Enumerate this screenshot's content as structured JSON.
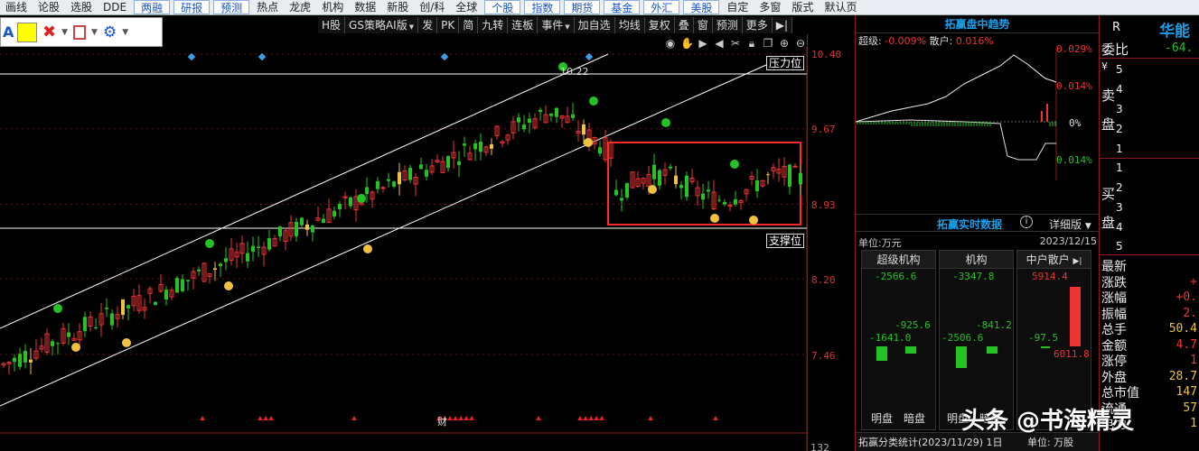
{
  "menu": [
    "画线",
    "论股",
    "选股",
    "DDE",
    "两融",
    "研报",
    "预测",
    "热点",
    "龙虎",
    "机构",
    "数据",
    "新股",
    "创/科",
    "全球",
    "个股",
    "指数",
    "期货",
    "基金",
    "外汇",
    "美股",
    "自定",
    "多窗",
    "版式",
    "默认页"
  ],
  "menu_highlight": [
    "两融",
    "研报",
    "预测",
    "个股",
    "指数",
    "期货",
    "基金",
    "外汇",
    "美股"
  ],
  "toolbox": {
    "a_label": "A",
    "yellow_color": "#ffff00"
  },
  "chart_toolbar": [
    "H股",
    "GS策略AI版",
    "发",
    "PK",
    "简",
    "九转",
    "连板",
    "事件",
    "加自选",
    "均线",
    "复权",
    "叠",
    "窗",
    "预测",
    "更多",
    "▶|"
  ],
  "chart_toolbar_dropdowns": [
    "GS策略AI版",
    "事件"
  ],
  "chart_icons": [
    "eye-icon",
    "hand-icon",
    "play-circle-icon",
    "left-circle-icon",
    "cut-icon",
    "lock-icon",
    "copy-icon",
    "zoom-in-icon",
    "zoom-out-icon"
  ],
  "price_axis": {
    "ticks": [
      "10.40",
      "9.67",
      "8.93",
      "8.20",
      "7.46"
    ],
    "bottom_label": "132"
  },
  "chart_annotations": {
    "resistance": "压力位",
    "support": "支撑位",
    "high_label": "10.22",
    "finance_marker": "财"
  },
  "colors": {
    "up": "#ee3333",
    "down": "#22c322",
    "signal_yellow": "#f0c040",
    "diamond": "#3aa0e8",
    "box": "#ff2a2a"
  },
  "right_panel": {
    "title": "拓赢盘中趋势",
    "super_label": "超级:",
    "super_value": "-0.009%",
    "retail_label": "散户:",
    "retail_value": "0.016%",
    "pct_top": "0.029%",
    "pct_mid_up": "0.014%",
    "pct_zero": "0%",
    "pct_mid_down": "0.014%",
    "realtime_title": "拓赢实时数据",
    "help": "i",
    "mode": "详细版",
    "unit": "单位:万元",
    "date": "2023/12/15",
    "columns": [
      {
        "name": "超级机构",
        "top": "-2566.6",
        "v1": "-925.6",
        "v2": "-1641.0",
        "foot1": "明盘",
        "foot2": "暗盘"
      },
      {
        "name": "机构",
        "top": "-3347.8",
        "v1": "-841.2",
        "v2": "-2506.6",
        "foot1": "明盘",
        "foot2": "暗盘"
      },
      {
        "name": "中户散户",
        "top": "5914.4",
        "v1": "-97.5",
        "v2": "6011.8",
        "foot1": "",
        "foot2": ""
      }
    ],
    "footer": "拓赢分类统计(2023/11/29) 1日",
    "footer_unit": "单位: 万股"
  },
  "quote_panel": {
    "r_label": "R",
    "name": "华能",
    "weibi_label": "委比",
    "weibi_value": "-64.",
    "sell_label": [
      "卖",
      "盘"
    ],
    "buy_label": [
      "买",
      "盘"
    ],
    "sell_levels": [
      "5",
      "4",
      "3",
      "2",
      "1"
    ],
    "buy_levels": [
      "1",
      "2",
      "3",
      "4",
      "5"
    ],
    "fields": [
      {
        "label": "最新",
        "value": ""
      },
      {
        "label": "涨跌",
        "value": "+"
      },
      {
        "label": "涨幅",
        "value": "+0."
      },
      {
        "label": "振幅",
        "value": "2."
      },
      {
        "label": "总手",
        "value": "50.4"
      },
      {
        "label": "金额",
        "value": "4.7"
      },
      {
        "label": "涨停",
        "value": "1"
      },
      {
        "label": "外盘",
        "value": "28.7"
      },
      {
        "label": "总市值",
        "value": "147"
      },
      {
        "label": "流通",
        "value": "57"
      },
      {
        "label": "电力",
        "value": "1"
      }
    ]
  },
  "watermark": "头条 @书海精灵"
}
